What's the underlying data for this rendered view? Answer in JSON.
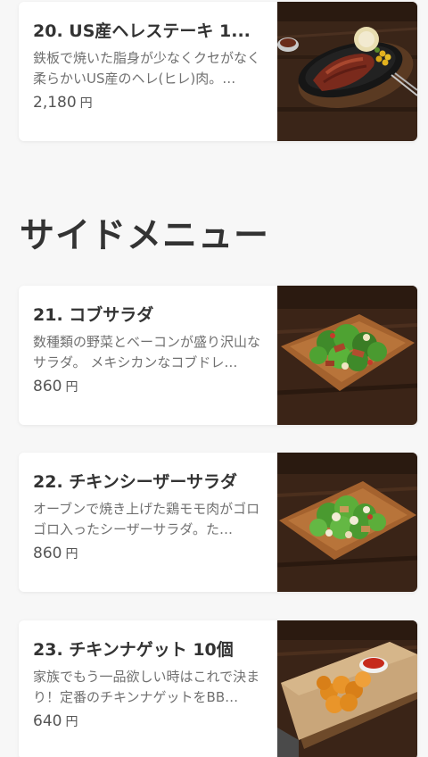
{
  "section": {
    "title": "サイドメニュー"
  },
  "items": [
    {
      "title": "20. US産ヘレステーキ 1...",
      "description": "鉄板で焼いた脂身が少なくクセがなく柔らかいUS産のヘレ(ヒレ)肉。…",
      "price": "2,180",
      "currency": "円",
      "image_icon": "steak-photo"
    },
    {
      "title": "21. コブサラダ",
      "description": "数種類の野菜とベーコンが盛り沢山なサラダ。 メキシカンなコブドレ…",
      "price": "860",
      "currency": "円",
      "image_icon": "cobb-salad-photo"
    },
    {
      "title": "22. チキンシーザーサラダ",
      "description": "オーブンで焼き上げた鶏モモ肉がゴロゴロ入ったシーザーサラダ。た…",
      "price": "860",
      "currency": "円",
      "image_icon": "caesar-salad-photo"
    },
    {
      "title": "23. チキンナゲット 10個",
      "description": "家族でもう一品欲しい時はこれで決まり！定番のチキンナゲットをBB…",
      "price": "640",
      "currency": "円",
      "image_icon": "chicken-nuggets-photo"
    }
  ]
}
